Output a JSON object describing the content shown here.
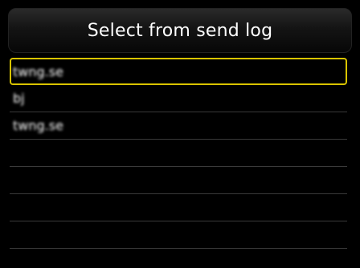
{
  "header": {
    "title": "Select from send log"
  },
  "send_log": {
    "entries": [
      {
        "label": "twng.se",
        "selected": true
      },
      {
        "label": "bj",
        "selected": false
      },
      {
        "label": "twng.se",
        "selected": false
      },
      {
        "label": "",
        "selected": false
      },
      {
        "label": "",
        "selected": false
      },
      {
        "label": "",
        "selected": false
      },
      {
        "label": "",
        "selected": false
      },
      {
        "label": "",
        "selected": false
      }
    ]
  },
  "colors": {
    "background": "#000000",
    "selection_border": "#d9c400",
    "divider": "#3a3a3a",
    "text": "#ffffff"
  }
}
